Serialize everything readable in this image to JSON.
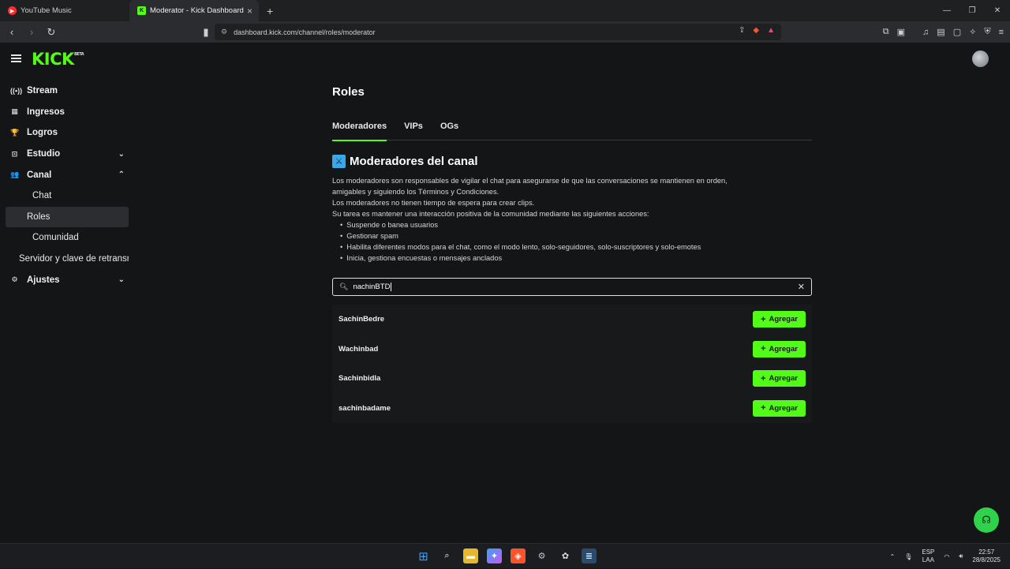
{
  "browser": {
    "tabs": [
      {
        "title": "YouTube Music",
        "active": false
      },
      {
        "title": "Moderator - Kick Dashboard",
        "active": true
      }
    ],
    "url": "dashboard.kick.com/channel/roles/moderator"
  },
  "header": {
    "logo": "KICK",
    "logo_badge": "BETA"
  },
  "sidebar": {
    "items": [
      {
        "label": "Stream"
      },
      {
        "label": "Ingresos"
      },
      {
        "label": "Logros"
      },
      {
        "label": "Estudio"
      },
      {
        "label": "Canal"
      },
      {
        "label": "Chat"
      },
      {
        "label": "Roles"
      },
      {
        "label": "Comunidad"
      },
      {
        "label": "Servidor y clave de retransr"
      },
      {
        "label": "Ajustes"
      }
    ]
  },
  "main": {
    "title": "Roles",
    "tabs": [
      {
        "label": "Moderadores",
        "active": true
      },
      {
        "label": "VIPs"
      },
      {
        "label": "OGs"
      }
    ],
    "section_title": "Moderadores del canal",
    "description": [
      "Los moderadores son responsables de vigilar el chat para asegurarse de que las conversaciones se mantienen en orden,",
      "amigables y siguiendo los Términos y Condiciones.",
      "Los moderadores no tienen tiempo de espera para crear clips.",
      "Su tarea es mantener una interacción positiva de la comunidad mediante las siguientes acciones:"
    ],
    "bullets": [
      "Suspende o banea usuarios",
      "Gestionar spam",
      "Habilita diferentes modos para el chat, como el modo lento, solo-seguidores, solo-suscriptores y solo-emotes",
      "Inicia, gestiona encuestas o mensajes anclados"
    ],
    "search_value": "nachinBTD",
    "results": [
      {
        "name": "SachinBedre",
        "button": "Agregar"
      },
      {
        "name": "Wachinbad",
        "button": "Agregar"
      },
      {
        "name": "Sachinbidla",
        "button": "Agregar"
      },
      {
        "name": "sachinbadame",
        "button": "Agregar"
      }
    ]
  },
  "taskbar": {
    "lang_1": "ESP",
    "lang_2": "LAA",
    "time": "22:57",
    "date": "28/8/2025"
  },
  "colors": {
    "accent": "#53fc18",
    "background": "#141517"
  }
}
